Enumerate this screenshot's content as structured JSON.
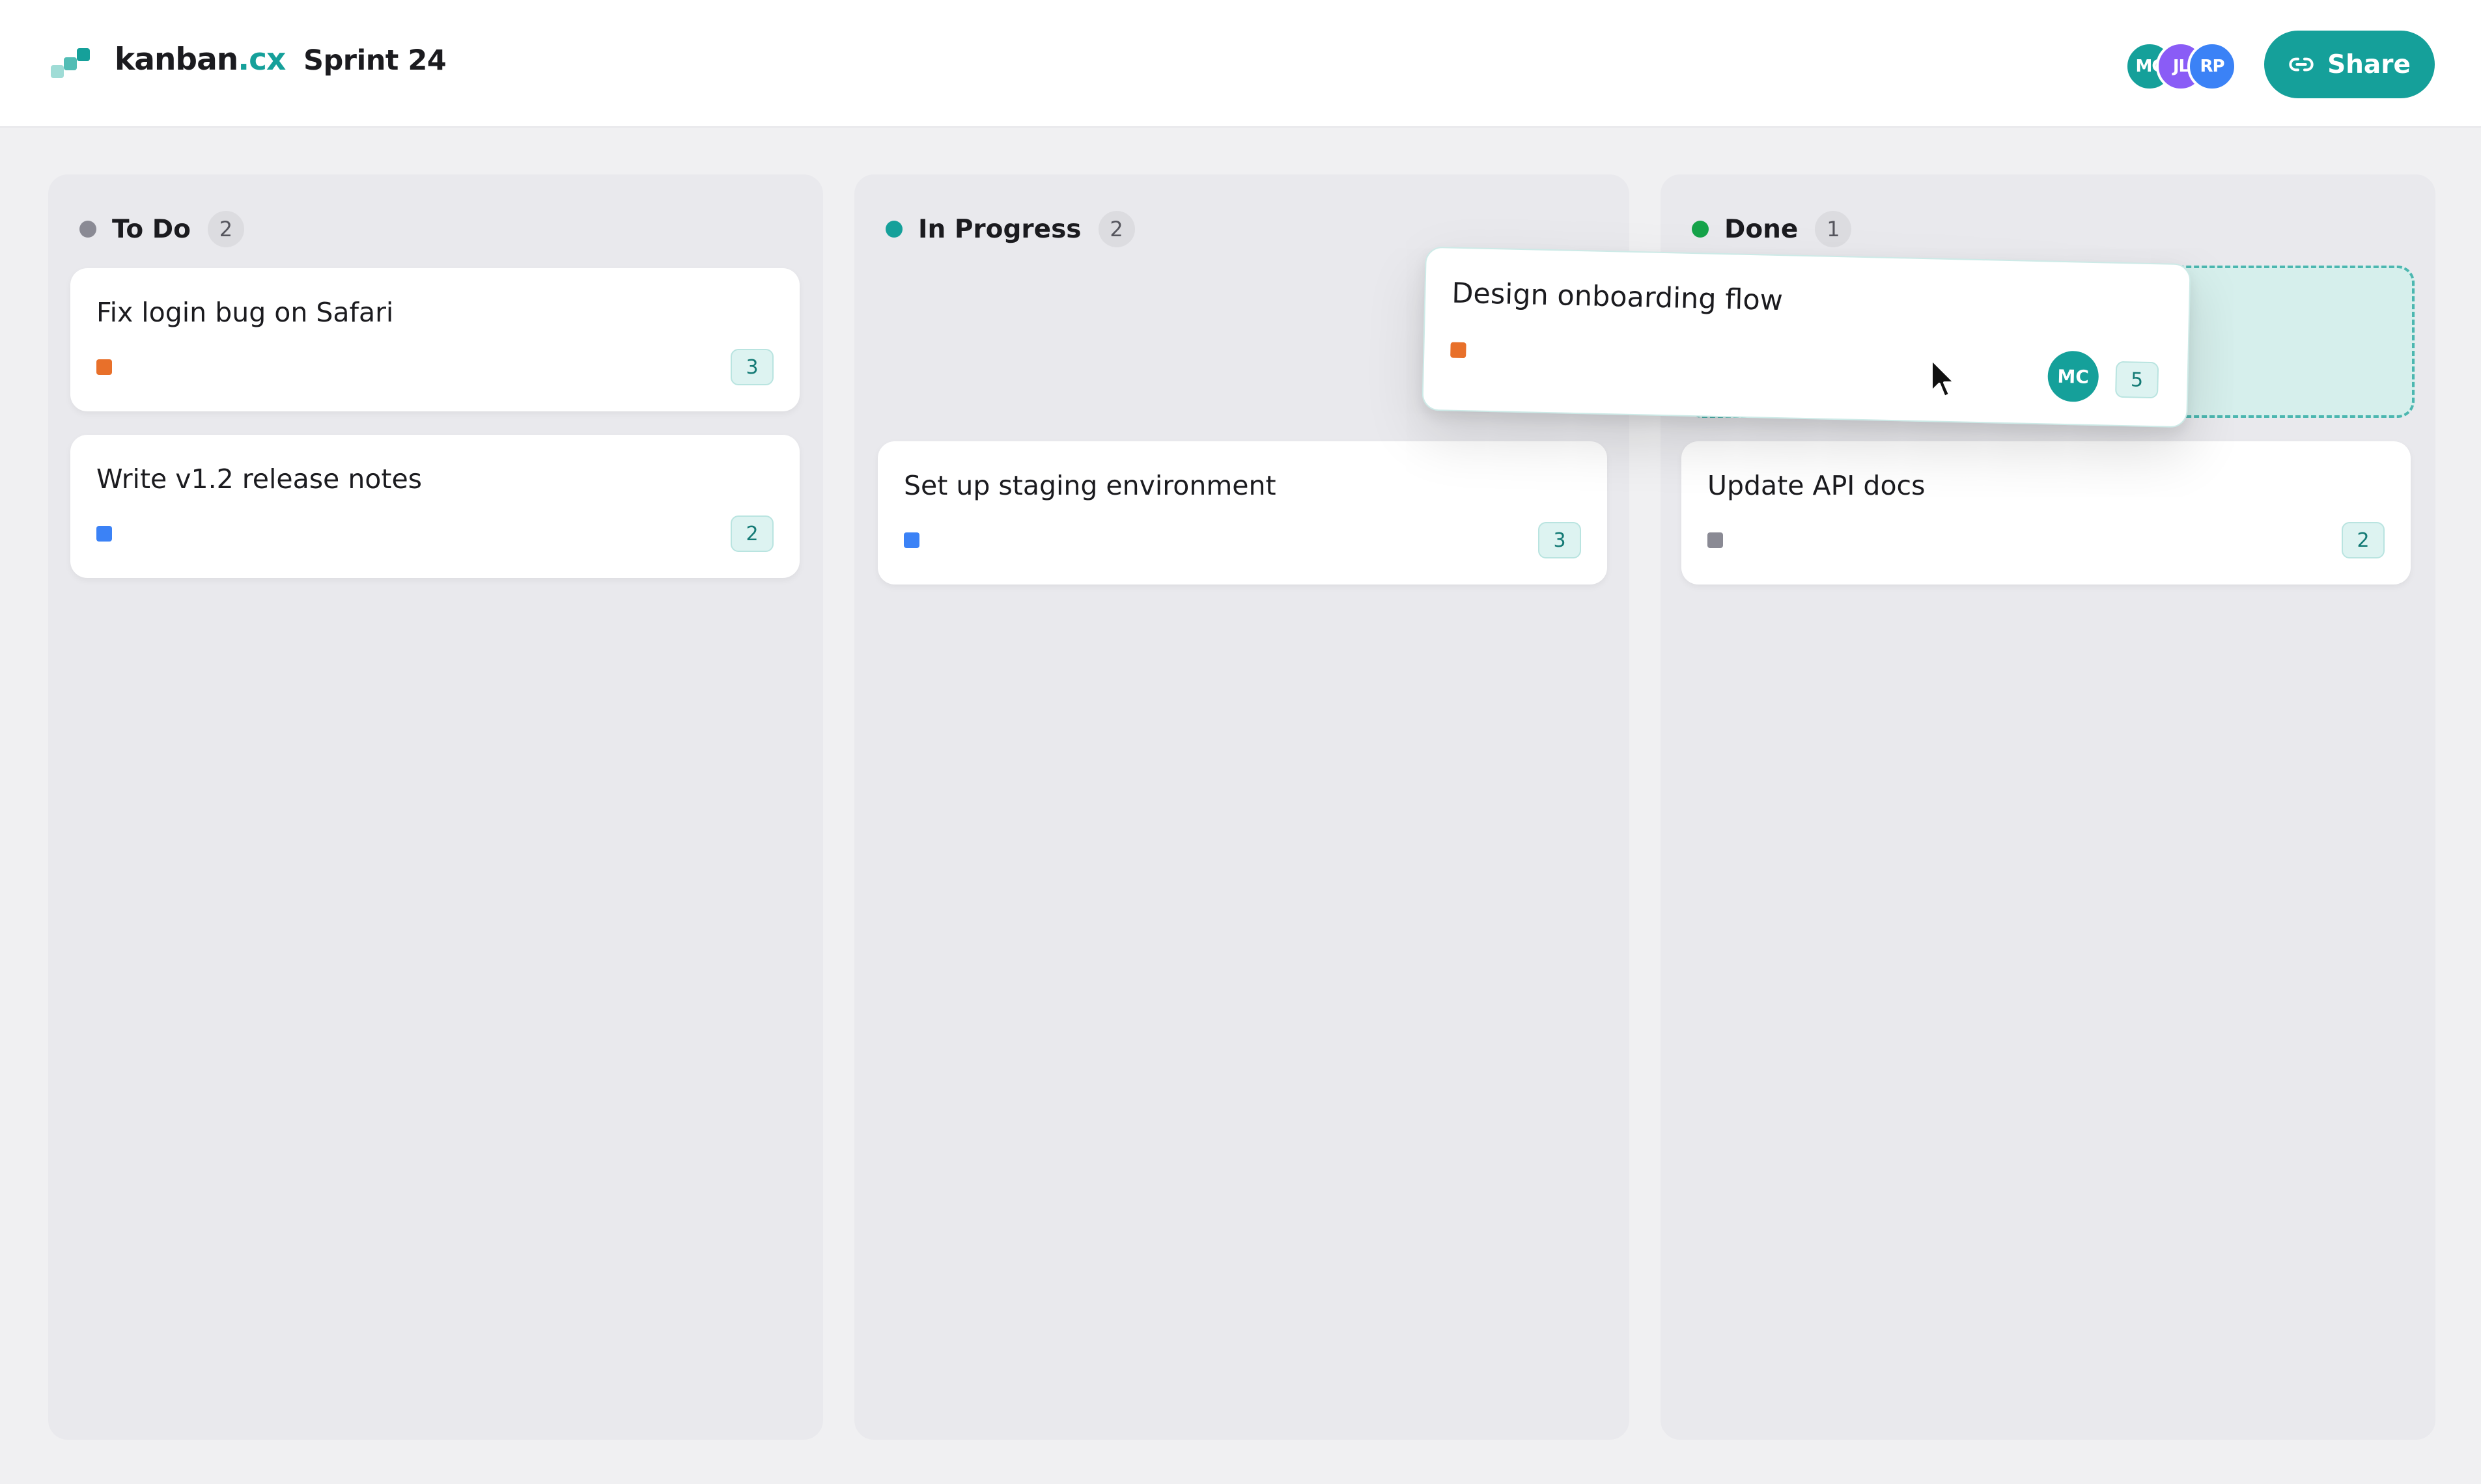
{
  "app": {
    "brand_name": "kanban",
    "brand_tld": ".cx",
    "board_title": "Sprint 24"
  },
  "header": {
    "avatars": [
      {
        "initials": "MC",
        "color": "#15a09a"
      },
      {
        "initials": "JL",
        "color": "#8a5cf6"
      },
      {
        "initials": "RP",
        "color": "#3b82f6"
      }
    ],
    "share_label": "Share",
    "share_icon": "link-icon"
  },
  "colors": {
    "accent": "#15a09a",
    "tag_orange": "#e8702a",
    "tag_blue": "#3b82f6",
    "tag_gray": "#8a8a94",
    "status_todo": "#8a8a94",
    "status_in_progress": "#15a09a",
    "status_done": "#16a34a"
  },
  "columns": [
    {
      "title": "To Do",
      "count": "2",
      "cards": [
        {
          "title": "Fix login bug on Safari",
          "points": "3",
          "tag_color": "#e8702a"
        },
        {
          "title": "Write v1.2 release notes",
          "points": "2",
          "tag_color": "#3b82f6"
        }
      ]
    },
    {
      "title": "In Progress",
      "count": "2",
      "cards": [
        {
          "title": "Set up staging environment",
          "points": "3",
          "tag_color": "#3b82f6"
        }
      ]
    },
    {
      "title": "Done",
      "count": "1",
      "cards": [
        {
          "title": "Update API docs",
          "points": "2",
          "tag_color": "#8a8a94"
        }
      ]
    }
  ],
  "dragging_card": {
    "title": "Design onboarding flow",
    "points": "5",
    "assignee": "MC",
    "tag_color": "#e8702a"
  },
  "cursor_icon": "pointer-cursor-icon"
}
